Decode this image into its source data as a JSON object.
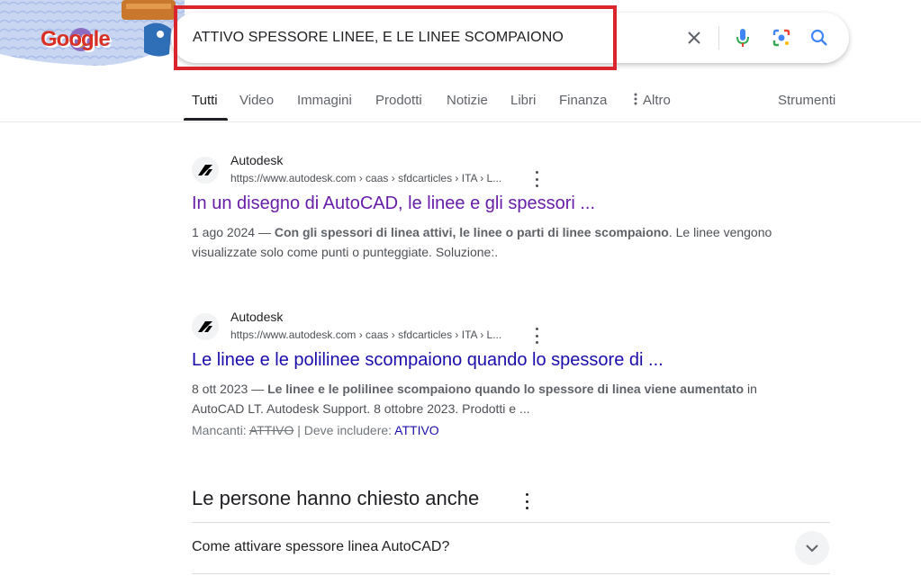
{
  "search": {
    "query": "ATTIVO SPESSORE LINEE, E LE LINEE SCOMPAIONO"
  },
  "logo": {
    "text": "Google"
  },
  "tabs": [
    {
      "label": "Tutti"
    },
    {
      "label": "Video"
    },
    {
      "label": "Immagini"
    },
    {
      "label": "Prodotti"
    },
    {
      "label": "Notizie"
    },
    {
      "label": "Libri"
    },
    {
      "label": "Finanza"
    },
    {
      "label": "Altro"
    }
  ],
  "tools_label": "Strumenti",
  "results": [
    {
      "site": "Autodesk",
      "url": "https://www.autodesk.com › caas › sfdcarticles › ITA › L...",
      "title": "In un disegno di AutoCAD, le linee e gli spessori ...",
      "date": "1 ago 2024 — ",
      "snippet_bold": "Con gli spessori di linea attivi, le linee o parti di linee scompaiono",
      "snippet_rest": ". Le linee vengono visualizzate solo come punti o punteggiate. Soluzione:."
    },
    {
      "site": "Autodesk",
      "url": "https://www.autodesk.com › caas › sfdcarticles › ITA › L...",
      "title": "Le linee e le polilinee scompaiono quando lo spessore di ...",
      "date": "8 ott 2023 — ",
      "snippet_bold": "Le linee e le polilinee scompaiono quando lo spessore di linea viene aumentato",
      "snippet_rest": " in AutoCAD LT. Autodesk Support. 8 ottobre 2023. Prodotti e ...",
      "missing_label": "Mancanti: ",
      "missing_term": "ATTIVO",
      "include_label": " | Deve includere: ",
      "include_term": "ATTIVO"
    }
  ],
  "paa": {
    "title": "Le persone hanno chiesto anche",
    "questions": [
      "Come attivare spessore linea AutoCAD?"
    ]
  },
  "colors": {
    "highlight_border": "#d9252b",
    "visited_link": "#681da8",
    "link": "#1a0dab"
  }
}
